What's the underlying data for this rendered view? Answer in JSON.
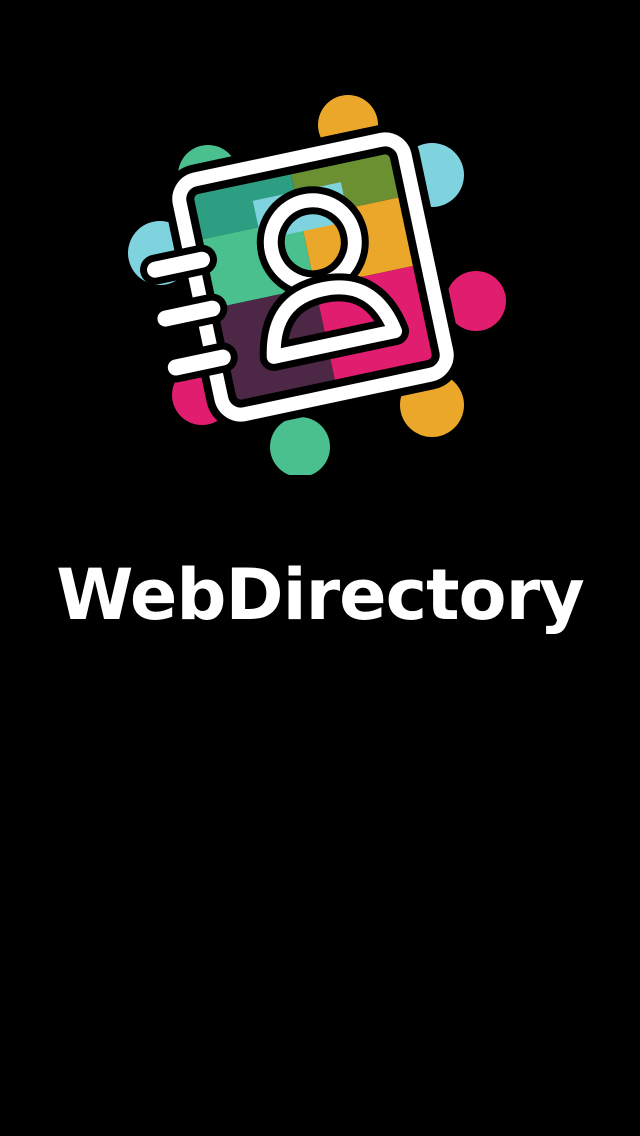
{
  "app": {
    "title": "WebDirectory"
  },
  "logo": {
    "icon": "address-book-icon",
    "colors": {
      "teal": "#49c08d",
      "sky": "#7fd3df",
      "orange": "#eba72a",
      "magenta": "#e01d6e",
      "olive": "#6a9032",
      "plum": "#4c2746",
      "outline": "#ffffff"
    }
  },
  "background": "#000000"
}
